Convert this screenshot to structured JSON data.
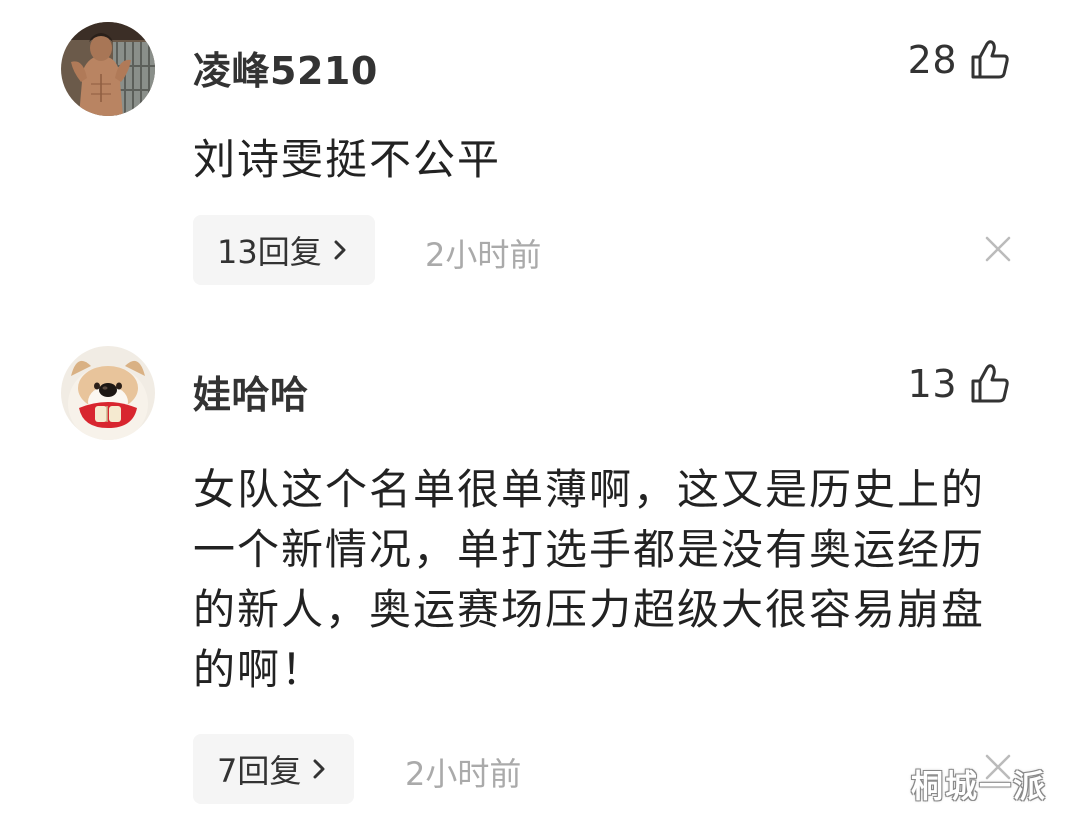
{
  "comments": [
    {
      "username": "凌峰5210",
      "likes": "28",
      "text": "刘诗雯挺不公平",
      "reply_label": "13回复",
      "time": "2小时前"
    },
    {
      "username": "娃哈哈",
      "likes": "13",
      "text": "女队这个名单很单薄啊，这又是历史上的一个新情况，单打选手都是没有奥运经历的新人，奥运赛场压力超级大很容易崩盘的啊！",
      "reply_label": "7回复",
      "time": "2小时前"
    }
  ],
  "watermark": "桐城一派",
  "icons": {
    "like": "thumbs-up-icon",
    "reply_arrow": "chevron-right-icon",
    "close": "close-icon"
  },
  "colors": {
    "text": "#222222",
    "muted": "#aaaaaa",
    "pill_bg": "#f5f5f5"
  }
}
